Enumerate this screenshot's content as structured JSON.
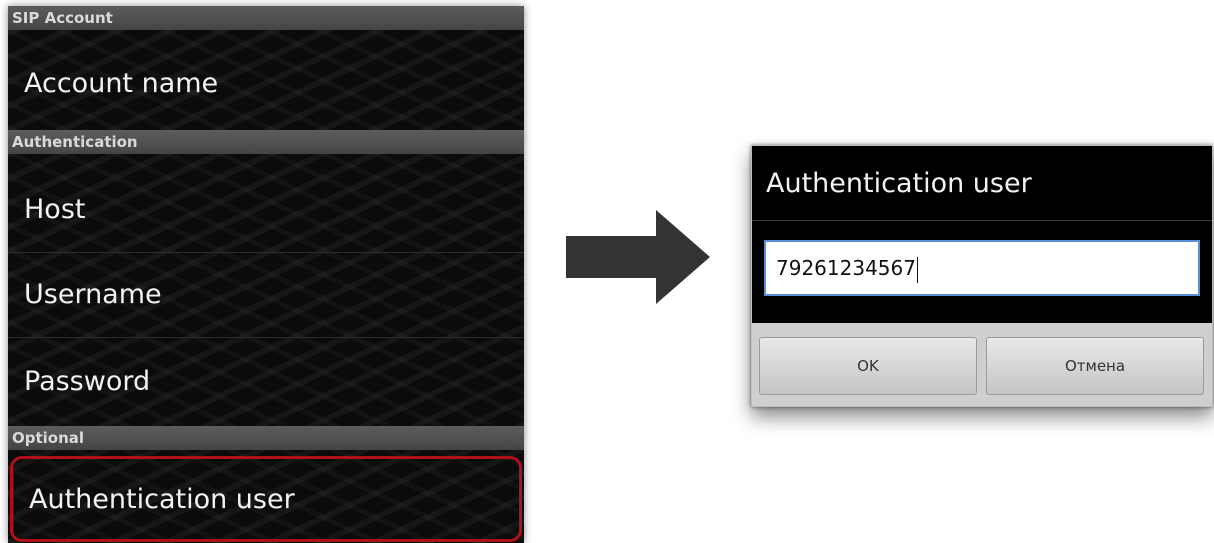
{
  "settings": {
    "sections": [
      {
        "header": "SIP Account",
        "items": [
          "Account name"
        ]
      },
      {
        "header": "Authentication",
        "items": [
          "Host",
          "Username",
          "Password"
        ]
      },
      {
        "header": "Optional",
        "items": [
          "Authentication user"
        ]
      }
    ],
    "highlighted_item": "Authentication user",
    "highlight_color": "#b0101b"
  },
  "arrow": {
    "icon": "right-arrow-icon",
    "color": "#333333"
  },
  "dialog": {
    "title": "Authentication user",
    "input_value": "79261234567",
    "input_border_color": "#5a8fd6",
    "buttons": {
      "ok": "OK",
      "cancel": "Отмена"
    }
  }
}
